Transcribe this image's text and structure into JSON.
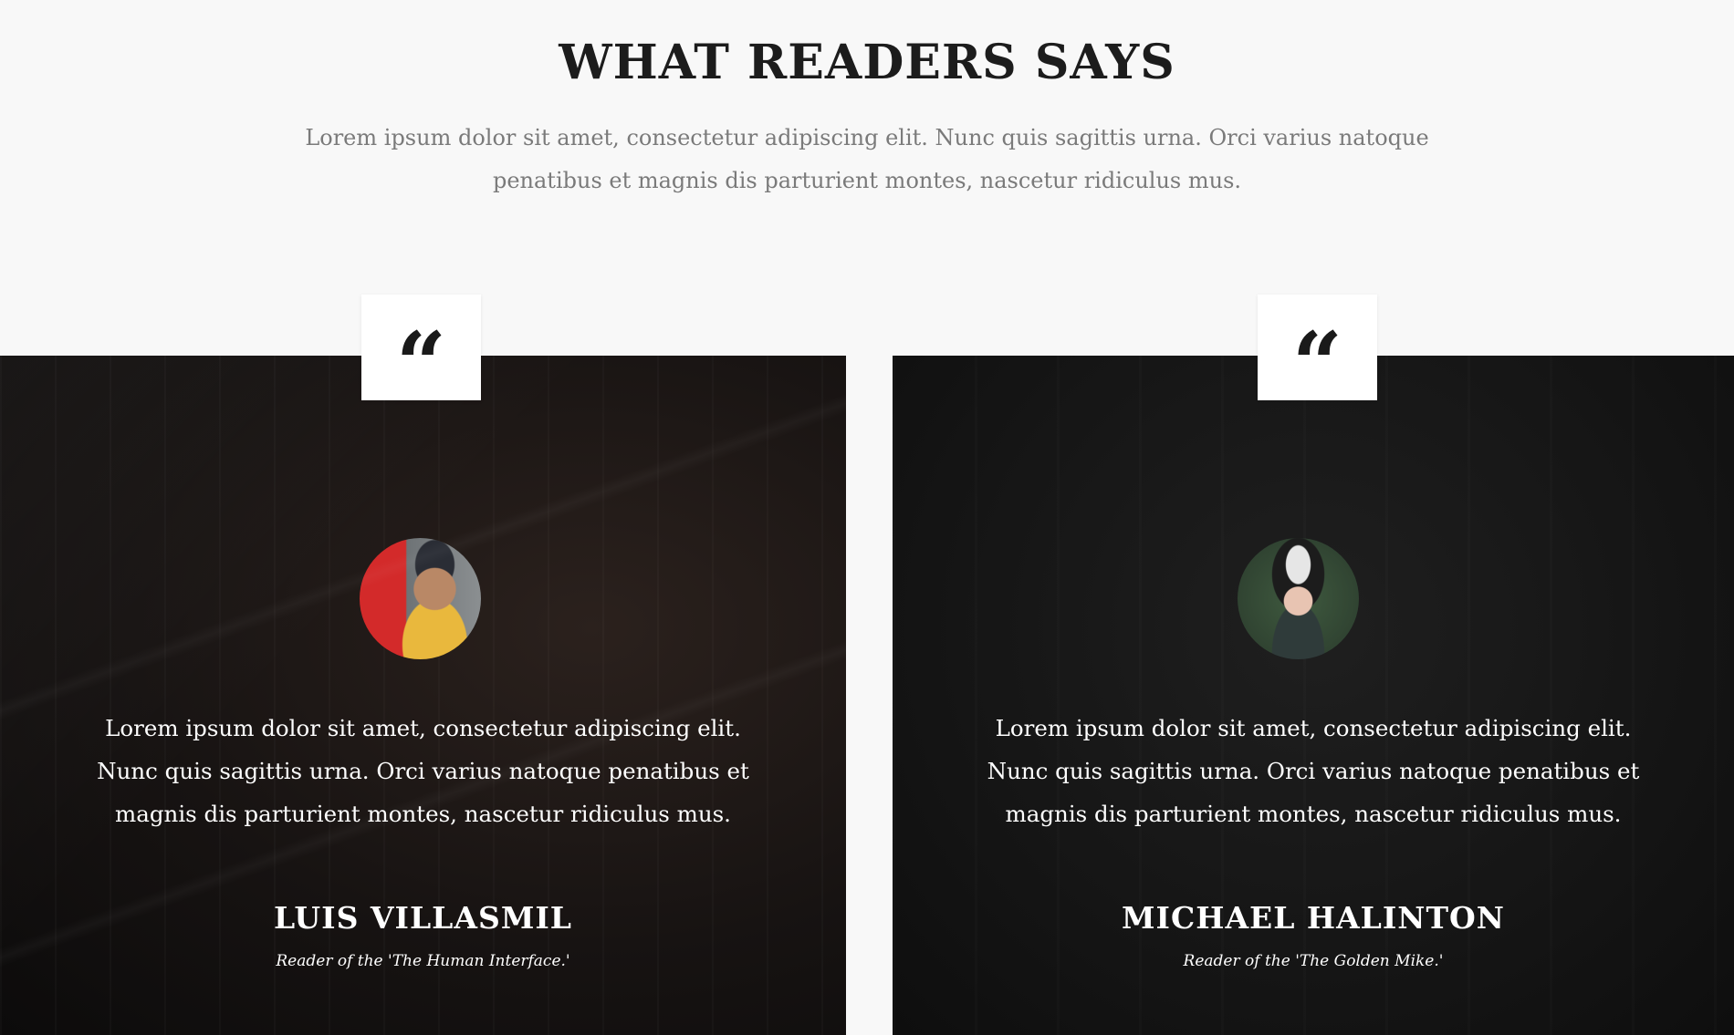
{
  "section": {
    "title": "What Readers Says",
    "subtitle": "Lorem ipsum dolor sit amet, consectetur adipiscing elit. Nunc quis sagittis urna. Orci varius natoque penatibus et magnis dis parturient montes, nascetur ridiculus mus."
  },
  "testimonials": [
    {
      "quote_icon": "quote-icon",
      "avatar_icon": "person-avatar",
      "text": "Lorem ipsum dolor sit amet, consectetur adipiscing elit. Nunc quis sagittis urna. Orci varius natoque penatibus et magnis dis parturient montes, nascetur ridiculus mus.",
      "name": "Luis Villasmil",
      "role": "Reader of the 'The Human Interface.'"
    },
    {
      "quote_icon": "quote-icon",
      "avatar_icon": "person-avatar",
      "text": "Lorem ipsum dolor sit amet, consectetur adipiscing elit. Nunc quis sagittis urna. Orci varius natoque penatibus et magnis dis parturient montes, nascetur ridiculus mus.",
      "name": "Michael Halinton",
      "role": "Reader of the 'The Golden Mike.'"
    }
  ],
  "colors": {
    "page_background": "#f8f8f8",
    "title_text": "#1c1c1c",
    "subtitle_text": "#7a7a7a",
    "card_text": "#ffffff",
    "quote_box": "#ffffff"
  }
}
